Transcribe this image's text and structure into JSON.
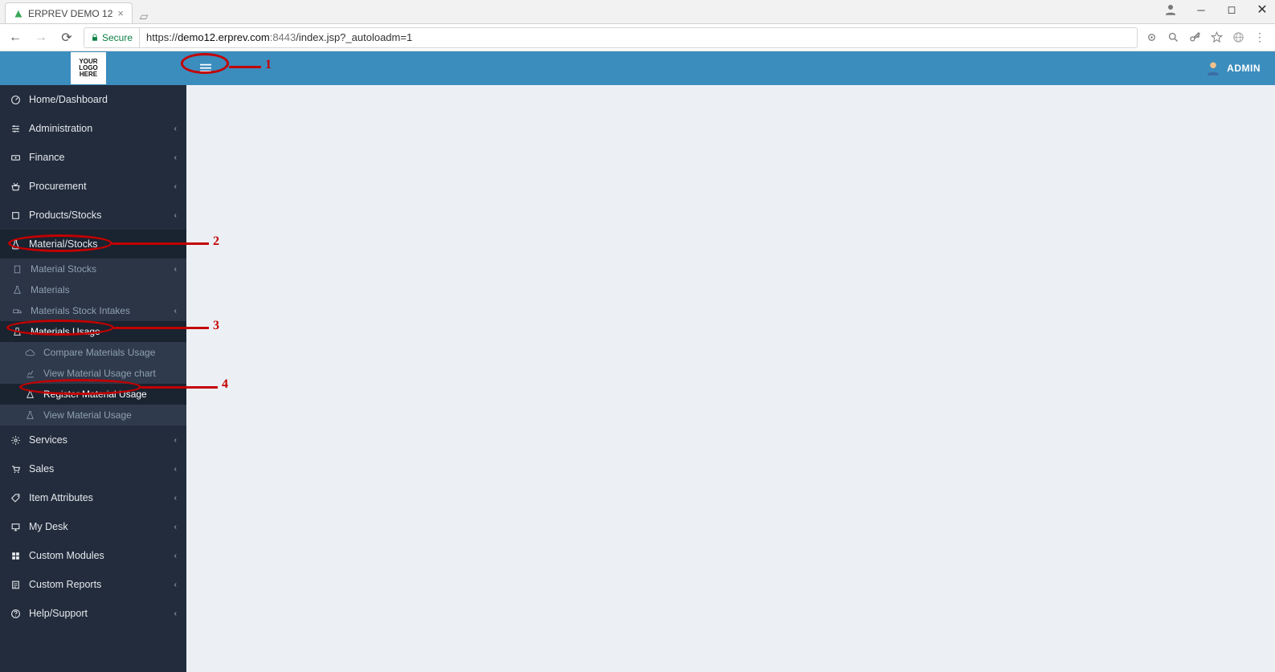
{
  "browser": {
    "tab_title": "ERPREV DEMO 12",
    "secure_label": "Secure",
    "url_scheme": "https://",
    "url_host": "demo12.erprev.com",
    "url_port": ":8443",
    "url_path": "/index.jsp?_autoloadm=1"
  },
  "header": {
    "logo_line1": "YOUR",
    "logo_line2": "LOGO",
    "logo_line3": "HERE",
    "user_label": "ADMIN"
  },
  "sidebar": {
    "items": [
      {
        "label": "Home/Dashboard",
        "icon": "dashboard",
        "chev": false
      },
      {
        "label": "Administration",
        "icon": "sliders",
        "chev": true
      },
      {
        "label": "Finance",
        "icon": "money",
        "chev": true
      },
      {
        "label": "Procurement",
        "icon": "truck",
        "chev": true
      },
      {
        "label": "Products/Stocks",
        "icon": "box",
        "chev": true
      },
      {
        "label": "Material/Stocks",
        "icon": "flask",
        "chev": true,
        "active": true
      },
      {
        "label": "Services",
        "icon": "gear",
        "chev": true
      },
      {
        "label": "Sales",
        "icon": "cart",
        "chev": true
      },
      {
        "label": "Item Attributes",
        "icon": "tags",
        "chev": true
      },
      {
        "label": "My Desk",
        "icon": "desktop",
        "chev": true
      },
      {
        "label": "Custom Modules",
        "icon": "modules",
        "chev": true
      },
      {
        "label": "Custom Reports",
        "icon": "report",
        "chev": true
      },
      {
        "label": "Help/Support",
        "icon": "help",
        "chev": true
      }
    ],
    "material_sub": [
      {
        "label": "Material Stocks",
        "chev": true
      },
      {
        "label": "Materials",
        "chev": false
      },
      {
        "label": "Materials Stock Intakes",
        "chev": true
      },
      {
        "label": "Materials Usage",
        "chev": false,
        "active": true
      }
    ],
    "usage_sub": [
      {
        "label": "Compare Materials Usage"
      },
      {
        "label": "View Material Usage chart"
      },
      {
        "label": "Register Material Usage",
        "active": true
      },
      {
        "label": "View Material Usage"
      }
    ]
  },
  "annotations": {
    "n1": "1",
    "n2": "2",
    "n3": "3",
    "n4": "4"
  }
}
